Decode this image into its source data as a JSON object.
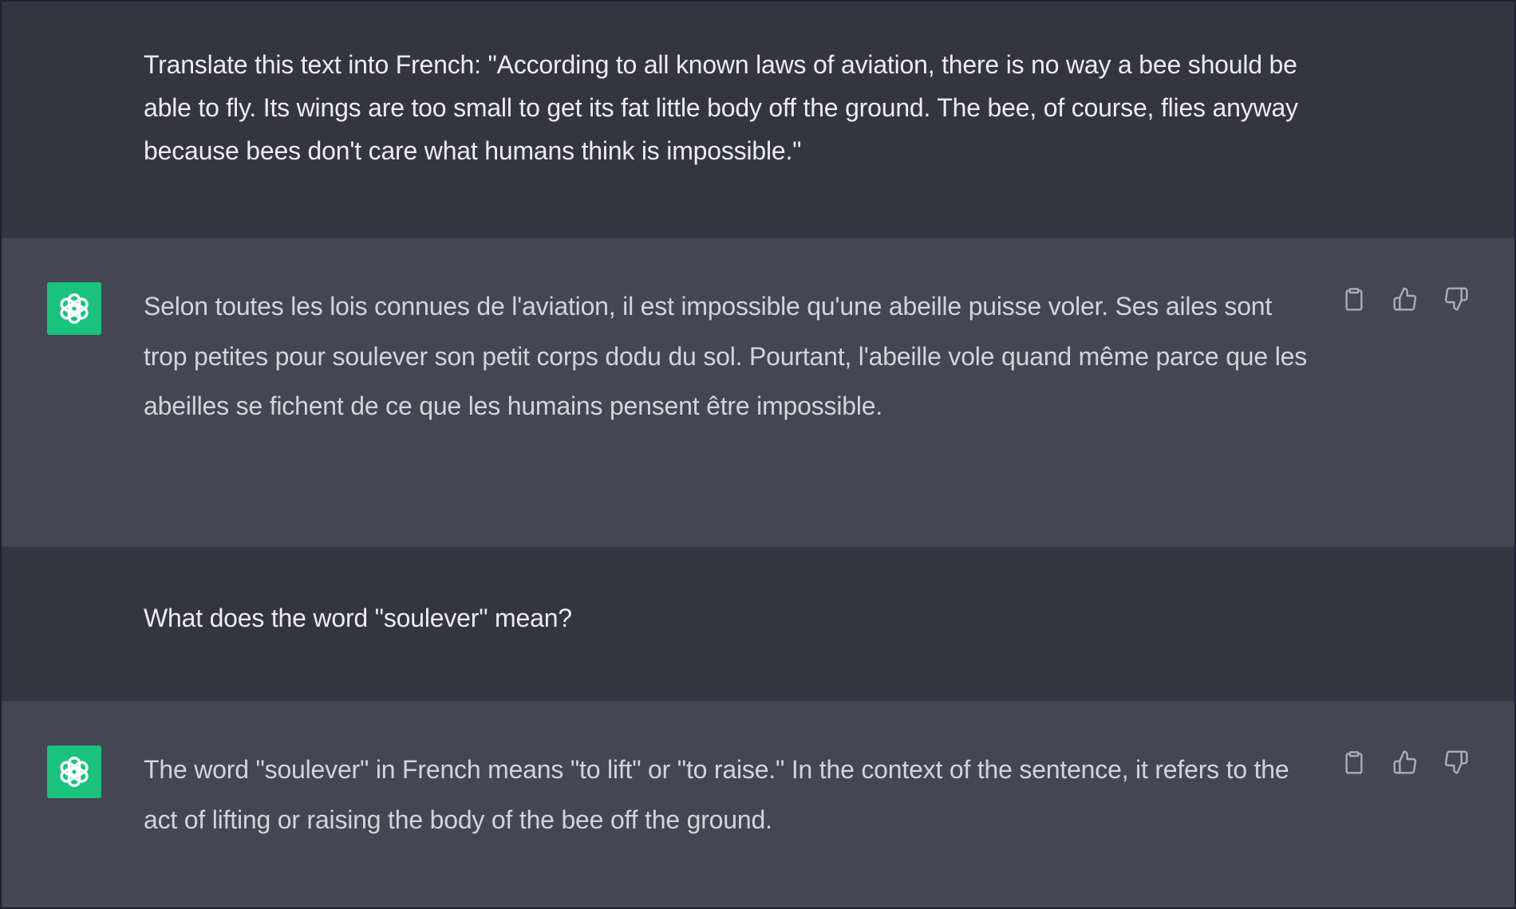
{
  "colors": {
    "user_background": "#343541",
    "assistant_background": "#444654",
    "avatar_background": "#19c37d",
    "user_text": "#ececf1",
    "assistant_text": "#d1d5db",
    "icon": "#acacbe"
  },
  "icons": {
    "avatar": "openai-logo-icon",
    "copy": "clipboard-icon",
    "like": "thumbs-up-icon",
    "dislike": "thumbs-down-icon"
  },
  "conversation": {
    "messages": [
      {
        "role": "user",
        "text": "Translate this text into French: \"According to all known laws of aviation, there is no way a bee should be able to fly. Its wings are too small to get its fat little body off the ground. The bee, of course, flies anyway because bees don't care what humans think is impossible.\""
      },
      {
        "role": "assistant",
        "text": "Selon toutes les lois connues de l'aviation, il est impossible qu'une abeille puisse voler. Ses ailes sont trop petites pour soulever son petit corps dodu du sol. Pourtant, l'abeille vole quand même parce que les abeilles se fichent de ce que les humains pensent être impossible."
      },
      {
        "role": "user",
        "text": "What does the word \"soulever\" mean?"
      },
      {
        "role": "assistant",
        "text": "The word \"soulever\" in French means \"to lift\" or \"to raise.\" In the context of the sentence, it refers to the act of lifting or raising the body of the bee off the ground."
      }
    ]
  }
}
